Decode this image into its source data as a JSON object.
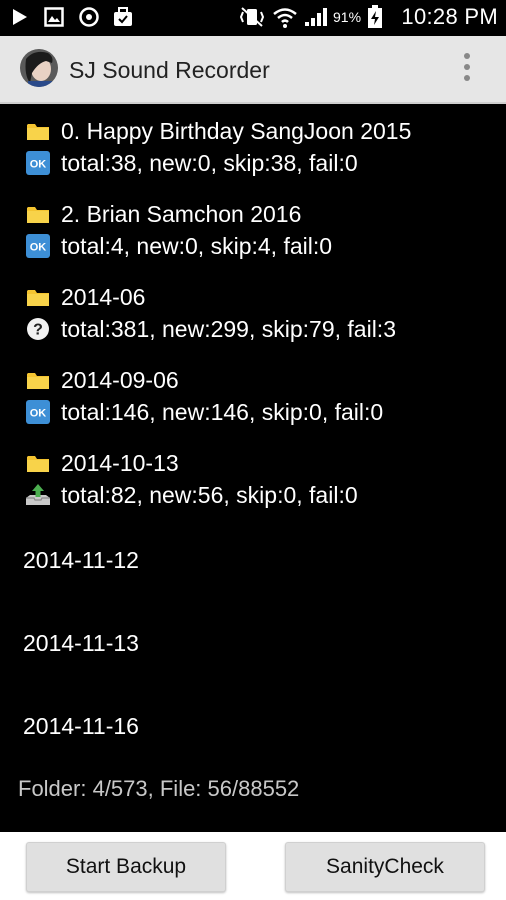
{
  "status_bar": {
    "battery_percent": "91%",
    "time": "10:28 PM"
  },
  "app_bar": {
    "title": "SJ Sound Recorder",
    "menu_icon": "more-vert-icon"
  },
  "folders": [
    {
      "name": "0. Happy Birthday SangJoon 2015",
      "status_icon": "ok-icon",
      "summary": "total:38, new:0, skip:38, fail:0"
    },
    {
      "name": "2. Brian Samchon 2016",
      "status_icon": "ok-icon",
      "summary": "total:4, new:0, skip:4, fail:0"
    },
    {
      "name": "2014-06",
      "status_icon": "question-icon",
      "summary": "total:381, new:299, skip:79, fail:3"
    },
    {
      "name": "2014-09-06",
      "status_icon": "ok-icon",
      "summary": "total:146, new:146, skip:0, fail:0"
    },
    {
      "name": "2014-10-13",
      "status_icon": "upload-tray-icon",
      "summary": "total:82, new:56, skip:0, fail:0"
    }
  ],
  "pending_folders": [
    "2014-11-12",
    "2014-11-13",
    "2014-11-16"
  ],
  "footer": {
    "progress_text": "Folder: 4/573, File: 56/88552"
  },
  "buttons": {
    "start_backup": "Start Backup",
    "sanity_check": "SanityCheck"
  },
  "colors": {
    "app_bar_bg": "#e6e6e6",
    "list_bg": "#000000",
    "ok_badge": "#3d8fd6",
    "folder": "#f4c430"
  }
}
